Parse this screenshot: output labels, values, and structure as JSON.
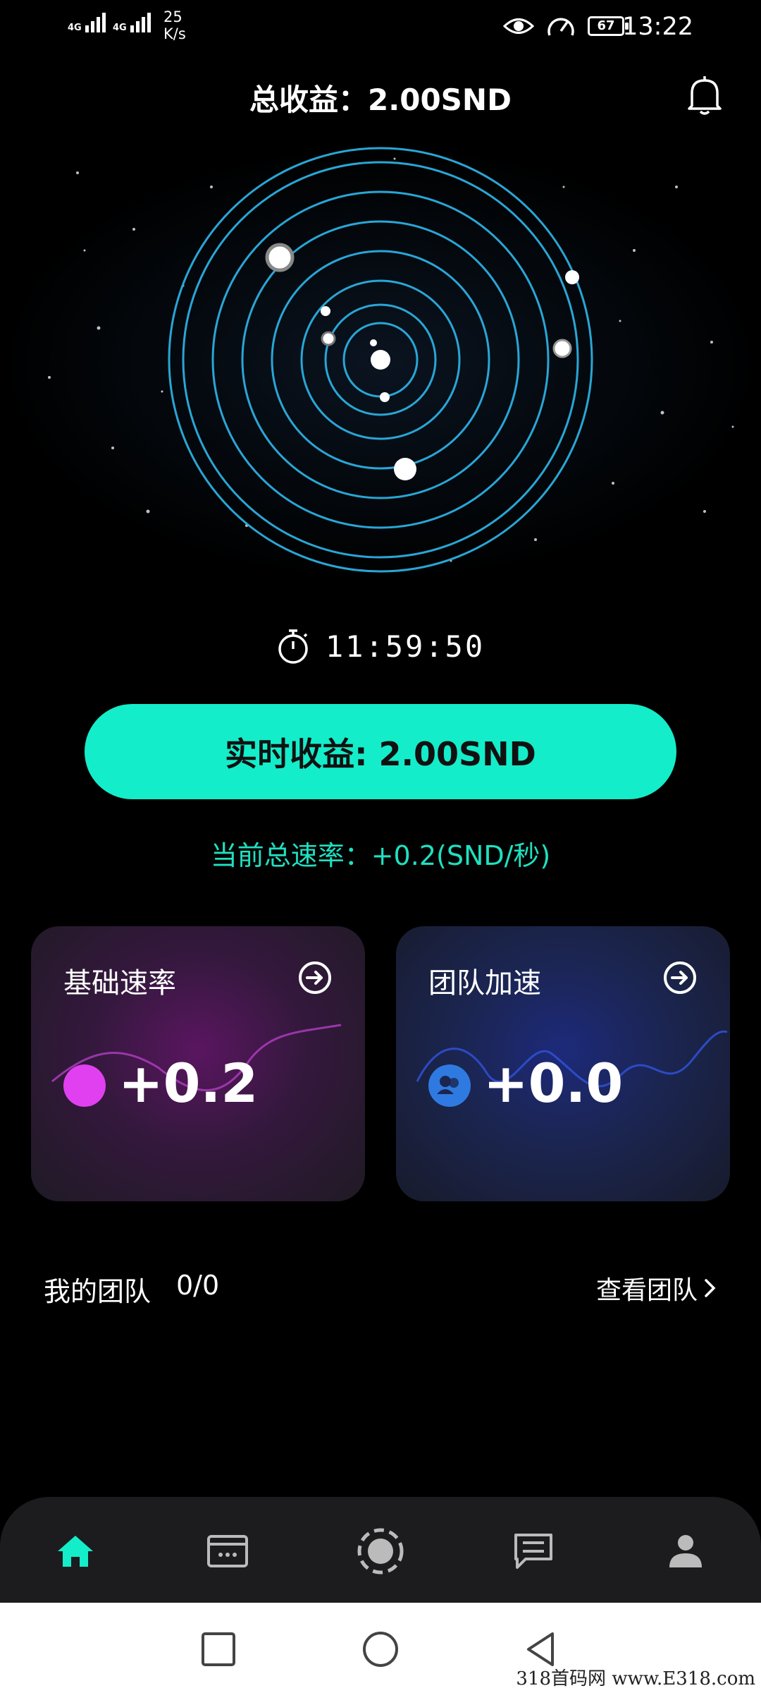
{
  "status_bar": {
    "net1": "4G",
    "net2": "4G",
    "speed_value": "25",
    "speed_unit": "K/s",
    "battery": "67",
    "time": "13:22",
    "icons": [
      "eye-icon",
      "speed-gauge-icon",
      "battery-icon"
    ]
  },
  "header": {
    "title": "总收益：2.00SND",
    "bell_icon": "bell-icon"
  },
  "timer": {
    "icon": "stopwatch-icon",
    "value": "11:59:50"
  },
  "realtime_button": {
    "label": "实时收益: 2.00SND"
  },
  "rate": {
    "text": "当前总速率：+0.2(SND/秒)"
  },
  "cards": [
    {
      "title": "基础速率",
      "value": "+0.2",
      "icon": "arrow-right-circle-icon",
      "dot_color": "#e040f0"
    },
    {
      "title": "团队加速",
      "value": "+0.0",
      "icon": "arrow-right-circle-icon",
      "dot_color": "#2f7ae0"
    }
  ],
  "team": {
    "label": "我的团队",
    "count": "0/0",
    "link": "查看团队"
  },
  "tabs": [
    {
      "name": "home-icon",
      "active": true
    },
    {
      "name": "wallet-icon",
      "active": false
    },
    {
      "name": "planet-icon",
      "active": false
    },
    {
      "name": "message-icon",
      "active": false
    },
    {
      "name": "profile-icon",
      "active": false
    }
  ],
  "colors": {
    "accent": "#14edc9",
    "orbit": "#29a6d6"
  },
  "watermark": "318首码网 www.E318.com"
}
